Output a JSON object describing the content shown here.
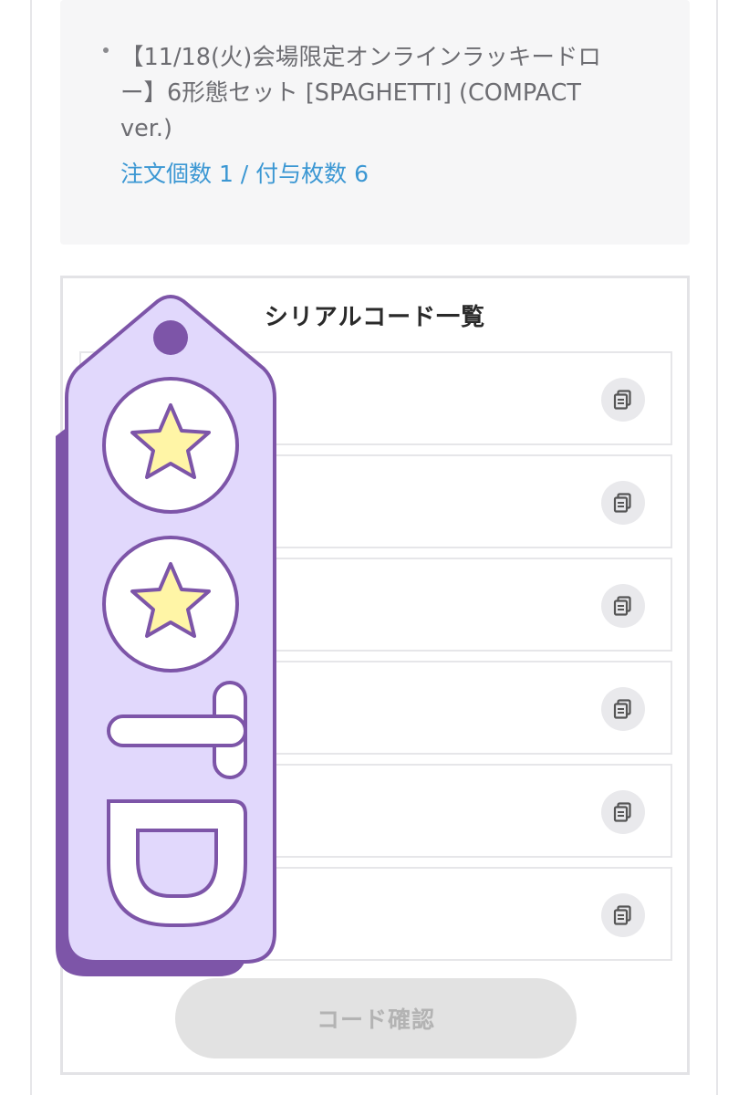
{
  "order": {
    "item_title": "【11/18(火)会場限定オンラインラッキードロー】6形態セット [SPAGHETTI] (COMPACT ver.)",
    "quantity_line": "注文個数 1 / 付与枚数 6"
  },
  "serial_section": {
    "heading": "シリアルコード一覧",
    "copy_icon": "copy-icon",
    "confirm_button_label": "コード確認"
  },
  "sticker": {
    "letters": "TD",
    "icon": "star-icon"
  },
  "colors": {
    "link_blue": "#3b97d3",
    "sticker_purple": "#e1d8fc",
    "sticker_outline": "#7d55a8",
    "star_yellow": "#fff5a6"
  }
}
